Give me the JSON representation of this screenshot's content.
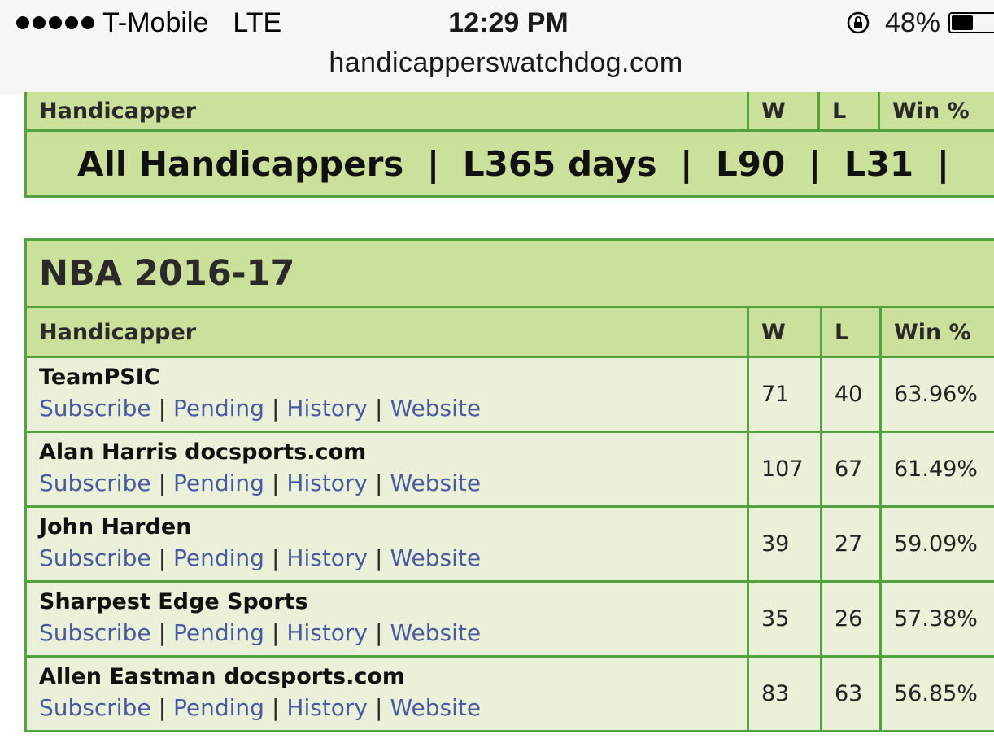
{
  "status_bar": {
    "carrier": "T-Mobile",
    "network": "LTE",
    "time": "12:29 PM",
    "battery_percent": "48%",
    "battery_level": 0.48,
    "url": "handicapperswatchdog.com"
  },
  "top_table": {
    "headers": {
      "handicapper": "Handicapper",
      "w": "W",
      "l": "L",
      "win_pct": "Win %"
    },
    "filters": [
      "All Handicappers",
      "L365 days",
      "L90",
      "L31"
    ],
    "separator": "|"
  },
  "nba_table": {
    "title": "NBA 2016-17",
    "headers": {
      "handicapper": "Handicapper",
      "w": "W",
      "l": "L",
      "win_pct": "Win %"
    },
    "link_labels": {
      "subscribe": "Subscribe",
      "pending": "Pending",
      "history": "History",
      "website": "Website"
    },
    "separator": "|",
    "rows": [
      {
        "name": "TeamPSIC",
        "w": "71",
        "l": "40",
        "win_pct": "63.96%"
      },
      {
        "name": "Alan Harris docsports.com",
        "w": "107",
        "l": "67",
        "win_pct": "61.49%"
      },
      {
        "name": "John Harden",
        "w": "39",
        "l": "27",
        "win_pct": "59.09%"
      },
      {
        "name": "Sharpest Edge Sports",
        "w": "35",
        "l": "26",
        "win_pct": "57.38%"
      },
      {
        "name": "Allen Eastman docsports.com",
        "w": "83",
        "l": "63",
        "win_pct": "56.85%"
      }
    ]
  },
  "colors": {
    "header_bg": "#cbe19b",
    "row_bg": "#ebf1d8",
    "border": "#52a33f",
    "link": "#4a5aa0"
  }
}
